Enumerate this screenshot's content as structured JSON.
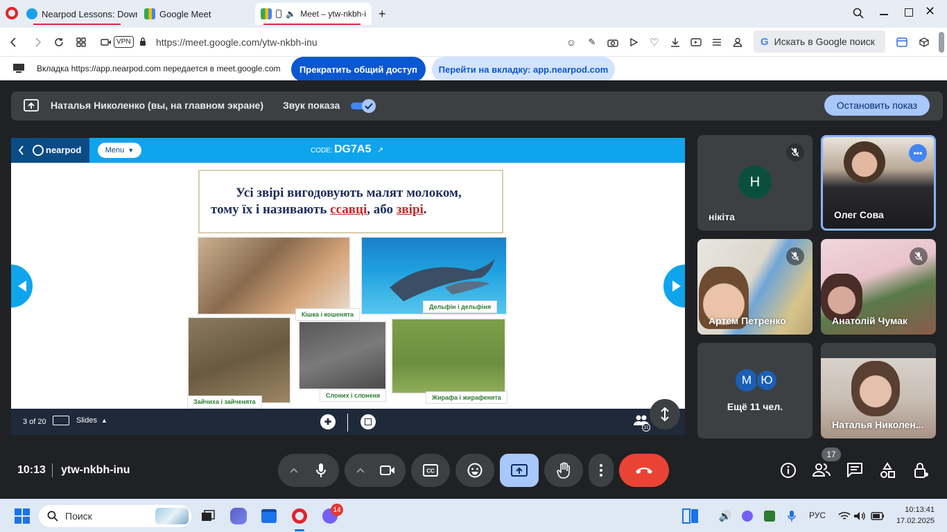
{
  "browser": {
    "tabs": [
      {
        "label": "Nearpod Lessons: Downlo"
      },
      {
        "label": "Google Meet"
      },
      {
        "label": "Meet – ytw-nkbh-i"
      }
    ],
    "url": "https://meet.google.com/ytw-nkbh-inu",
    "vpn_label": "VPN",
    "search_label": "Искать в Google поиск"
  },
  "sharing_banner": {
    "text": "Вкладка https://app.nearpod.com передается в meet.google.com",
    "stop_label": "Прекратить общий доступ",
    "goto_label": "Перейти на вкладку: app.nearpod.com"
  },
  "present_bar": {
    "presenter": "Наталья Николенко (вы, на главном экране)",
    "audio_label": "Звук показа",
    "audio_on": true,
    "stop_label": "Остановить показ"
  },
  "nearpod": {
    "logo": "nearpod",
    "menu_label": "Menu",
    "code_label": "CODE:",
    "code": "DG7A5",
    "slide_text_1": "Усі звірі вигодовують малят молоком,",
    "slide_text_2": "тому їх і називають",
    "slide_word_1": "ссавці",
    "slide_text_3": ", або",
    "slide_word_2": "звірі",
    "slide_text_4": ".",
    "captions": [
      "Кішка і кошенята",
      "Дельфін і дельфіня",
      "Зайчиха і зайченята",
      "Слоних і слоненя",
      "Жирафа і жирафенята"
    ],
    "slide_counter": "3 of 20",
    "slides_label": "Slides",
    "participants_badge": "11"
  },
  "participants": [
    {
      "name": "нікіта",
      "initial": "Н",
      "muted": true
    },
    {
      "name": "Олег Сова",
      "muted": false
    },
    {
      "name": "Артем Петренко",
      "muted": true
    },
    {
      "name": "Анатолій Чумак",
      "muted": true
    },
    {
      "name": "Ещё 11 чел.",
      "initials": [
        "М",
        "Ю"
      ]
    },
    {
      "name": "Наталья Николен..."
    }
  ],
  "meeting": {
    "time": "10:13",
    "code": "ytw-nkbh-inu",
    "people_count": "17"
  },
  "taskbar": {
    "search_label": "Поиск",
    "badge": "14",
    "lang": "РУС",
    "time": "10:13:41",
    "date": "17.02.2025"
  },
  "colors": {
    "meet_bg": "#202124",
    "nearpod_blue": "#0ea5ec",
    "end_call": "#ea4335",
    "accent_blue": "#a8c7fa",
    "share_button": "#0b57d0"
  }
}
